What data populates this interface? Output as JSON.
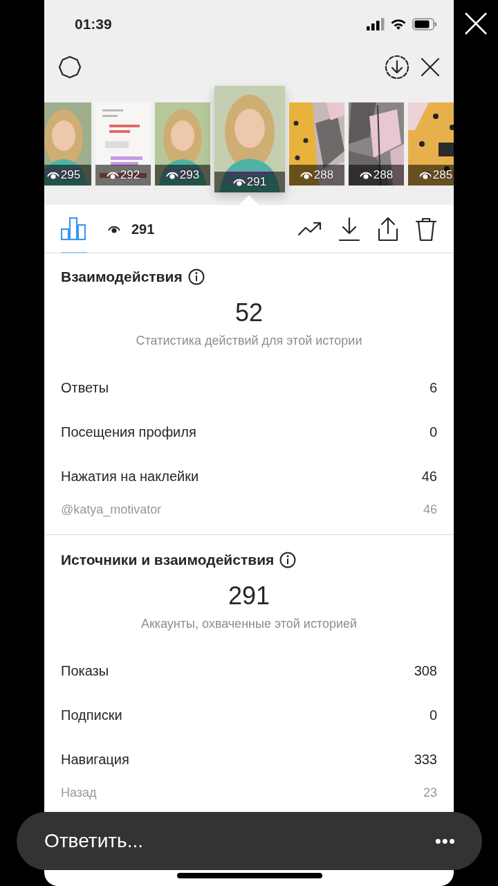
{
  "status_bar": {
    "time": "01:39"
  },
  "thumbnails": [
    {
      "views": "295",
      "selected": false
    },
    {
      "views": "292",
      "selected": false
    },
    {
      "views": "293",
      "selected": false
    },
    {
      "views": "291",
      "selected": true
    },
    {
      "views": "288",
      "selected": false
    },
    {
      "views": "288",
      "selected": false
    },
    {
      "views": "285",
      "selected": false
    }
  ],
  "tabs": [
    {
      "kind": "insights",
      "selected": true
    },
    {
      "kind": "viewers",
      "label": "291",
      "selected": false
    }
  ],
  "sections": [
    {
      "title": "Взаимодействия",
      "total": "52",
      "caption": "Статистика действий для этой истории",
      "rows": [
        {
          "kind": "main",
          "label": "Ответы",
          "value": "6"
        },
        {
          "kind": "main",
          "label": "Посещения профиля",
          "value": "0"
        },
        {
          "kind": "main",
          "label": "Нажатия на наклейки",
          "value": "46"
        },
        {
          "kind": "sub",
          "label": "@katya_motivator",
          "value": "46"
        }
      ]
    },
    {
      "title": "Источники и взаимодействия",
      "total": "291",
      "caption": "Аккаунты, охваченные этой историей",
      "rows": [
        {
          "kind": "main",
          "label": "Показы",
          "value": "308"
        },
        {
          "kind": "main",
          "label": "Подписки",
          "value": "0"
        },
        {
          "kind": "main",
          "label": "Навигация",
          "value": "333"
        },
        {
          "kind": "sub",
          "label": "Назад",
          "value": "23"
        }
      ]
    }
  ],
  "reply_bar": {
    "placeholder": "Ответить...",
    "more": "•••"
  }
}
